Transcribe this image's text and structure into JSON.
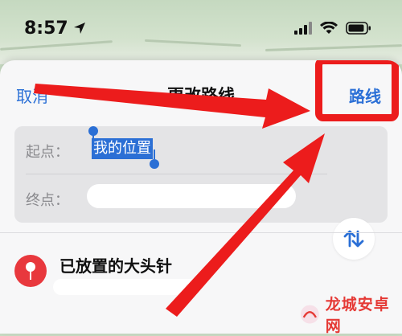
{
  "status_bar": {
    "time": "8:57",
    "icons": [
      "location-arrow-icon",
      "signal-icon",
      "wifi-icon",
      "battery-icon"
    ]
  },
  "header": {
    "cancel_label": "取消",
    "title": "更改路线",
    "route_label": "路线"
  },
  "fields": {
    "start_label": "起点：",
    "start_value": "我的位置",
    "end_label": "终点：",
    "end_value": ""
  },
  "swap_icon": "swap-arrows-icon",
  "list": {
    "items": [
      {
        "title": "已放置的大头针",
        "subtitle": "",
        "icon": "pin-icon"
      }
    ]
  },
  "watermark": {
    "text": "龙城安卓网"
  },
  "colors": {
    "accent": "#2a6fd6",
    "annotation_red": "#ec1c1c",
    "pin_red": "#e8383d",
    "sheet_bg": "#f7f7f8"
  }
}
